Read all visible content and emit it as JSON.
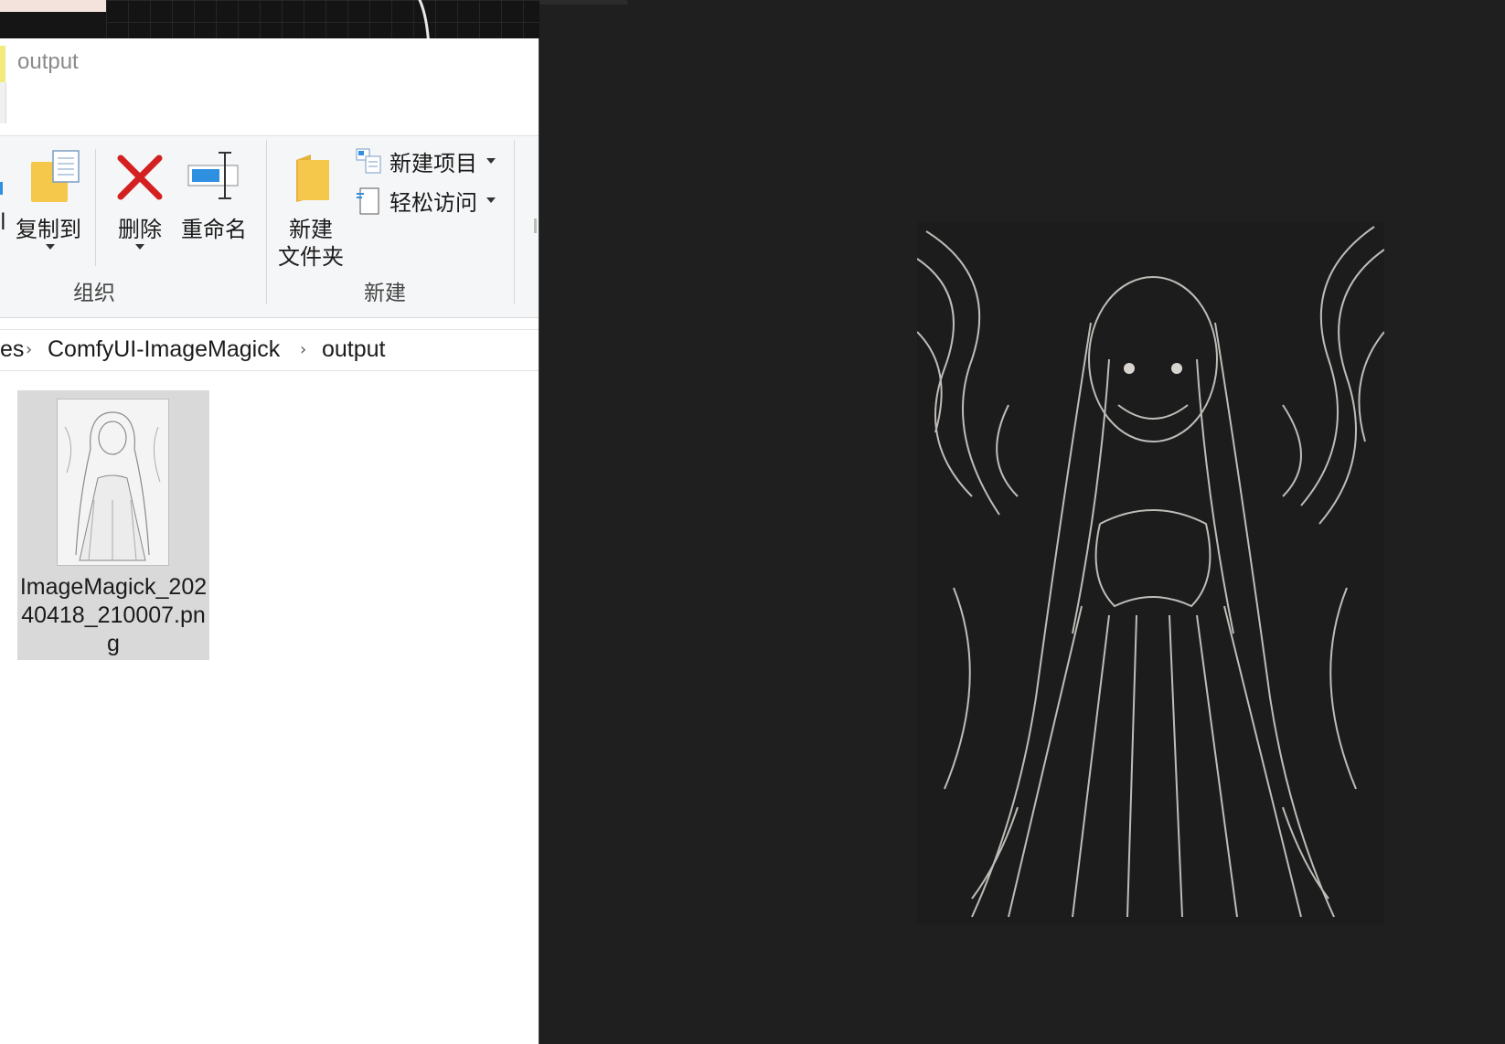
{
  "window": {
    "title": "output"
  },
  "ribbon": {
    "partial_left_label": "l",
    "copy_to": "复制到",
    "delete": "删除",
    "rename": "重命名",
    "new_folder_line1": "新建",
    "new_folder_line2": "文件夹",
    "new_item": "新建项目",
    "easy_access": "轻松访问",
    "group_organize": "组织",
    "group_new": "新建"
  },
  "address": {
    "crumbs": [
      "es",
      "ComfyUI-ImageMagick",
      "output"
    ]
  },
  "files": [
    {
      "name": "ImageMagick_20240418_210007.png"
    }
  ],
  "preview": {
    "description_icon": "image-preview"
  },
  "colors": {
    "delete_red": "#d42020",
    "folder_yellow": "#f5c84c",
    "rename_blue": "#2f8fe0",
    "canvas_dark": "#1f1f1f"
  }
}
